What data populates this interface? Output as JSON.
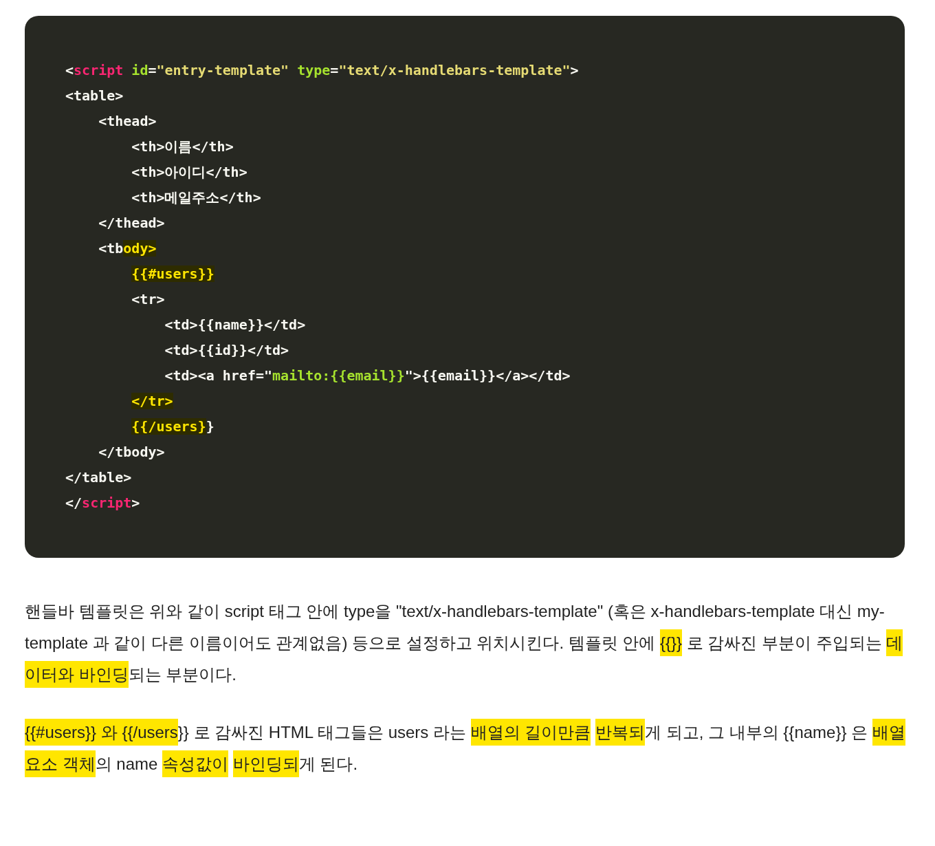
{
  "code_block": {
    "lines": [
      [
        {
          "text": "<",
          "kind": "text"
        },
        {
          "text": "script",
          "kind": "tag"
        },
        {
          "text": " id",
          "kind": "attr"
        },
        {
          "text": "=",
          "kind": "text"
        },
        {
          "text": "\"entry-template\"",
          "kind": "string"
        },
        {
          "text": " type",
          "kind": "attr"
        },
        {
          "text": "=",
          "kind": "text"
        },
        {
          "text": "\"text/x-handlebars-template\"",
          "kind": "string"
        },
        {
          "text": ">",
          "kind": "text"
        }
      ],
      [
        {
          "text": "<table>",
          "kind": "text"
        }
      ],
      [
        {
          "text": "    <thead>",
          "kind": "text"
        }
      ],
      [
        {
          "text": "        <th>이름</th>",
          "kind": "text"
        }
      ],
      [
        {
          "text": "        <th>아이디</th>",
          "kind": "text"
        }
      ],
      [
        {
          "text": "        <th>메일주소</th>",
          "kind": "text"
        }
      ],
      [
        {
          "text": "    </thead>",
          "kind": "text"
        }
      ],
      [
        {
          "text": "    <tb",
          "kind": "text"
        },
        {
          "text": "ody>",
          "kind": "marked"
        }
      ],
      [
        {
          "text": "        {{#users}}",
          "kind": "marked"
        }
      ],
      [
        {
          "text": "        <tr>",
          "kind": "text"
        }
      ],
      [
        {
          "text": "            <td>{{name}}</td>",
          "kind": "text"
        }
      ],
      [
        {
          "text": "            <td>{{id}}</td>",
          "kind": "text"
        }
      ],
      [
        {
          "text": "            <td><a href=\"",
          "kind": "text"
        },
        {
          "text": "mailto:{{email}}",
          "kind": "link"
        },
        {
          "text": "\">{{email}}</a></td>",
          "kind": "text"
        }
      ],
      [
        {
          "text": "        </tr>",
          "kind": "marked"
        }
      ],
      [
        {
          "text": "        {{/users}",
          "kind": "marked"
        },
        {
          "text": "}",
          "kind": "text"
        }
      ],
      [
        {
          "text": "    </tbody>",
          "kind": "text"
        }
      ],
      [
        {
          "text": "</table>",
          "kind": "text"
        }
      ],
      [
        {
          "text": "</",
          "kind": "text"
        },
        {
          "text": "script",
          "kind": "tag"
        },
        {
          "text": ">",
          "kind": "text"
        }
      ]
    ]
  },
  "paragraphs": [
    [
      {
        "text": "핸들바 템플릿은 위와 같이 script 태그 안에 type을 \"text/x-handlebars-template\" (혹은 x-handlebars-template 대신 my-template 과 같이 다른 이름이어도 관계없음) 등으로 설정하고 위치시킨다. 템플릿 안에 ",
        "highlighted": false
      },
      {
        "text": "{{}}",
        "highlighted": true
      },
      {
        "text": " 로 감싸진 부분이 주입되는 ",
        "highlighted": false
      },
      {
        "text": "데이터와 바인딩",
        "highlighted": true
      },
      {
        "text": "되는 부분이다.",
        "highlighted": false
      }
    ],
    [
      {
        "text": "{{#users}} 와 {{/users",
        "highlighted": true
      },
      {
        "text": "}} 로 감싸진 HTML 태그들은 users 라는 ",
        "highlighted": false
      },
      {
        "text": "배열의 길이만큼",
        "highlighted": true
      },
      {
        "text": " 반복되",
        "highlighted": true
      },
      {
        "text": "게 되고, 그 내부의 {{name}} 은 ",
        "highlighted": false
      },
      {
        "text": "배열 요소 객체",
        "highlighted": true
      },
      {
        "text": "의 name ",
        "highlighted": false
      },
      {
        "text": "속성값이",
        "highlighted": true
      },
      {
        "text": " 바인딩되",
        "highlighted": true
      },
      {
        "text": "게 된다.",
        "highlighted": false
      }
    ]
  ]
}
